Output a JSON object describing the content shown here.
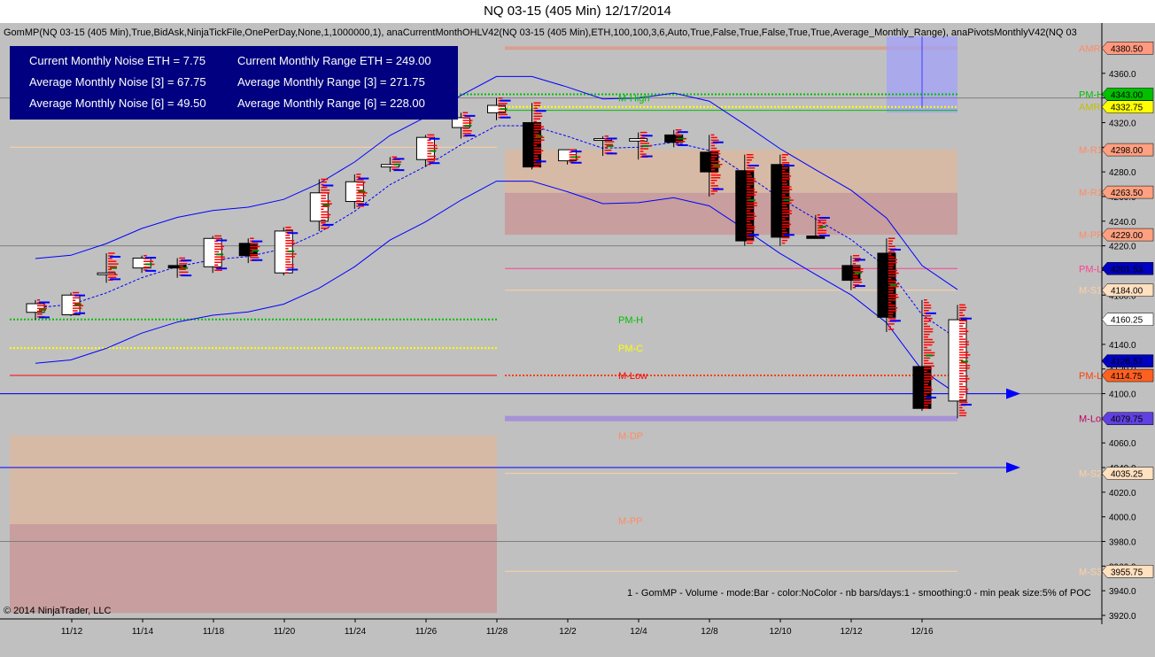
{
  "window": {
    "title": "NQ 03-15 (405 Min)  12/17/2014"
  },
  "indicator_line": "GomMP(NQ 03-15 (405 Min),True,BidAsk,NinjaTickFile,OnePerDay,None,1,1000000,1), anaCurrentMonthOHLV42(NQ 03-15 (405 Min),ETH,100,100,3,6,Auto,True,False,True,False,True,True,Average_Monthly_Range), anaPivotsMonthlyV42(NQ 03",
  "info_box": {
    "rows": [
      {
        "left": "Current Monthly Noise ETH = 7.75",
        "right": "Current Monthly Range ETH = 249.00"
      },
      {
        "left": "Average Monthly Noise [3] = 67.75",
        "right": "Average Monthly Range [3] = 271.75"
      },
      {
        "left": "Average Monthly Noise [6] = 49.50",
        "right": "Average Monthly Range [6] = 228.00"
      }
    ]
  },
  "copyright": "© 2014 NinjaTrader, LLC",
  "footnote": "1 - GomMP - Volume - mode:Bar - color:NoColor - nb bars/days:1 - smoothing:0 - min peak size:5% of POC",
  "colors": {
    "background": "#c0c0c0",
    "up_candle": "#ffffff",
    "down_candle": "#000000",
    "envelope": "#0000ff",
    "volume_profile": "#ff0000",
    "info_bg": "#000080"
  },
  "chart_data": {
    "type": "candlestick",
    "title": "NQ 03-15 (405 Min)  12/17/2014",
    "ylim": [
      3920,
      4390
    ],
    "y_ticks": [
      3920,
      3940,
      3960,
      3980,
      4000,
      4020,
      4040,
      4060,
      4080,
      4100,
      4120,
      4140,
      4160,
      4180,
      4200,
      4220,
      4240,
      4260,
      4280,
      4300,
      4320,
      4340,
      4360,
      4380
    ],
    "x_tick_labels": [
      "11/12",
      "11/14",
      "11/18",
      "11/20",
      "11/24",
      "11/26",
      "11/28",
      "12/2",
      "12/4",
      "12/8",
      "12/10",
      "12/12",
      "12/16"
    ],
    "candles": [
      {
        "o": 4166,
        "h": 4176,
        "l": 4160,
        "c": 4173
      },
      {
        "o": 4164,
        "h": 4182,
        "l": 4163,
        "c": 4180
      },
      {
        "o": 4198,
        "h": 4214,
        "l": 4190,
        "c": 4198
      },
      {
        "o": 4202,
        "h": 4212,
        "l": 4198,
        "c": 4210
      },
      {
        "o": 4204,
        "h": 4210,
        "l": 4194,
        "c": 4202
      },
      {
        "o": 4203,
        "h": 4228,
        "l": 4198,
        "c": 4226
      },
      {
        "o": 4222,
        "h": 4226,
        "l": 4206,
        "c": 4212
      },
      {
        "o": 4198,
        "h": 4235,
        "l": 4196,
        "c": 4232
      },
      {
        "o": 4240,
        "h": 4274,
        "l": 4232,
        "c": 4263
      },
      {
        "o": 4256,
        "h": 4278,
        "l": 4250,
        "c": 4272
      },
      {
        "o": 4284,
        "h": 4292,
        "l": 4280,
        "c": 4286
      },
      {
        "o": 4290,
        "h": 4310,
        "l": 4284,
        "c": 4308
      },
      {
        "o": 4316,
        "h": 4328,
        "l": 4307,
        "c": 4324
      },
      {
        "o": 4328,
        "h": 4340,
        "l": 4322,
        "c": 4334
      },
      {
        "o": 4320,
        "h": 4336,
        "l": 4282,
        "c": 4284
      },
      {
        "o": 4289,
        "h": 4298,
        "l": 4286,
        "c": 4298
      },
      {
        "o": 4307,
        "h": 4309,
        "l": 4293,
        "c": 4307
      },
      {
        "o": 4305,
        "h": 4312,
        "l": 4290,
        "c": 4307
      },
      {
        "o": 4310,
        "h": 4314,
        "l": 4300,
        "c": 4304
      },
      {
        "o": 4296,
        "h": 4310,
        "l": 4260,
        "c": 4280
      },
      {
        "o": 4281,
        "h": 4294,
        "l": 4220,
        "c": 4224
      },
      {
        "o": 4286,
        "h": 4294,
        "l": 4220,
        "c": 4227
      },
      {
        "o": 4228,
        "h": 4245,
        "l": 4226,
        "c": 4226
      },
      {
        "o": 4204,
        "h": 4212,
        "l": 4184,
        "c": 4192
      },
      {
        "o": 4214,
        "h": 4226,
        "l": 4150,
        "c": 4162
      },
      {
        "o": 4122,
        "h": 4176,
        "l": 4086,
        "c": 4088
      },
      {
        "o": 4094,
        "h": 4172,
        "l": 4080,
        "c": 4160
      }
    ],
    "levels": [
      {
        "name": "AMR",
        "price": 4380.5,
        "color": "#ff8c64",
        "badge_text": "4380.50"
      },
      {
        "name": "PM-H",
        "price": 4343.0,
        "color": "#00c000",
        "badge_text": "4343.00"
      },
      {
        "name": "AMR",
        "price": 4332.75,
        "color": "#ffff00",
        "badge_text": "4332.75"
      },
      {
        "name": "M-R1",
        "price": 4298.0,
        "color": "#ff8c64",
        "badge_text": "4298.00"
      },
      {
        "name": "M-R1",
        "price": 4263.5,
        "color": "#ff8c64",
        "badge_text": "4263.50"
      },
      {
        "name": "M-PP",
        "price": 4229.0,
        "color": "#ff8c64",
        "badge_text": "4229.00"
      },
      {
        "name": "PM-L",
        "price": 4201.53,
        "color": "#ff4090",
        "badge_text": "4201.53"
      },
      {
        "name": "M-S1",
        "price": 4184.0,
        "color": "#ffd0a0",
        "badge_text": "4184.00"
      },
      {
        "name": "",
        "price": 4160.25,
        "color": "#0000ff",
        "badge_text": "4160.25"
      },
      {
        "name": "",
        "price": 4126.57,
        "color": "#0000ff",
        "badge_text": "4126.57"
      },
      {
        "name": "PM-L",
        "price": 4114.75,
        "color": "#ff4000",
        "badge_text": "4114.75"
      },
      {
        "name": "M-Lo",
        "price": 4079.75,
        "color": "#8000ff",
        "badge_text": "4079.75"
      },
      {
        "name": "M-S2",
        "price": 4035.25,
        "color": "#ffd0a0",
        "badge_text": "4035.25"
      },
      {
        "name": "M-S3",
        "price": 3955.75,
        "color": "#ffd0a0",
        "badge_text": "3955.75"
      }
    ],
    "mid_labels": [
      {
        "text": "M-High",
        "price": 4340,
        "color": "#00c000"
      },
      {
        "text": "PM-H",
        "price": 4160,
        "color": "#00c000"
      },
      {
        "text": "PM-C",
        "price": 4137,
        "color": "#ffff00"
      },
      {
        "text": "M-Low",
        "price": 4114.75,
        "color": "#ff0000"
      },
      {
        "text": "M-DP",
        "price": 4066,
        "color": "#ff8c64"
      },
      {
        "text": "M-PP",
        "price": 3997,
        "color": "#ff8c64"
      }
    ]
  }
}
